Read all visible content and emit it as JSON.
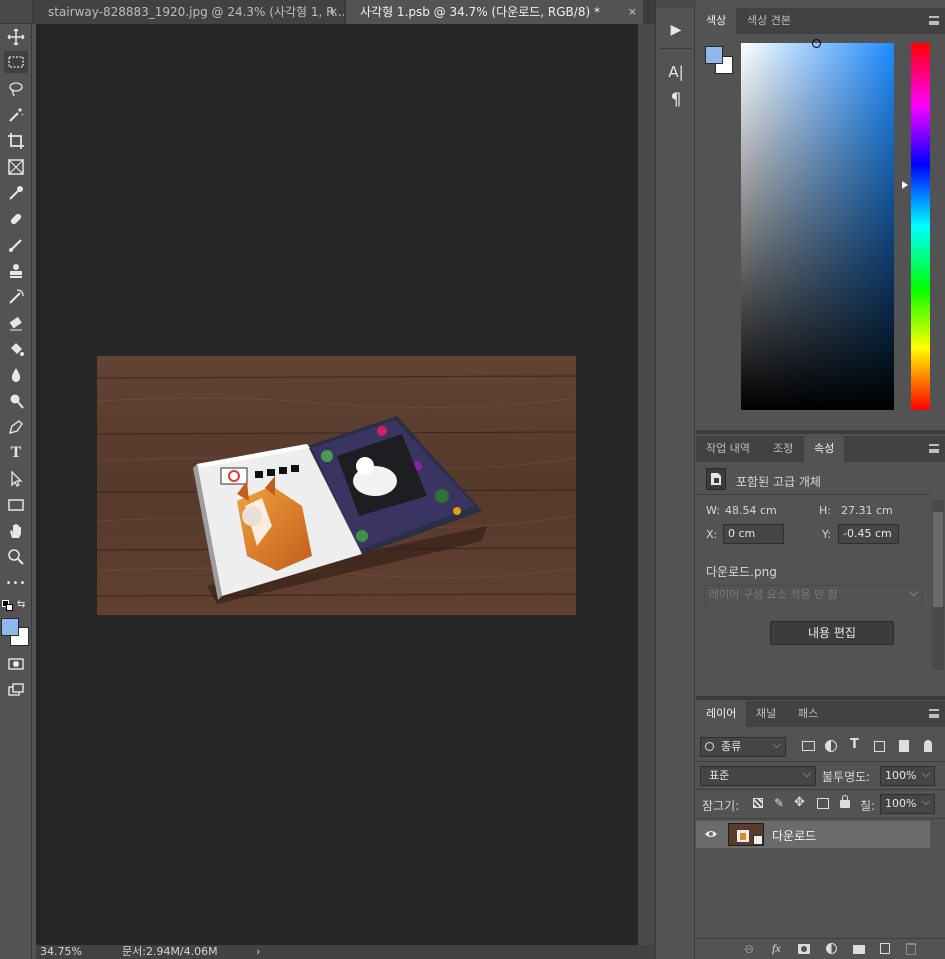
{
  "colors": {
    "foreground": "#8fb8ec",
    "background": "#ffffff",
    "canvas": "#262626",
    "panel": "#535353"
  },
  "tabs": [
    {
      "label": "stairway-828883_1920.jpg @ 24.3% (사각형 1, R...",
      "close": "×"
    },
    {
      "label": "사각형 1.psb @ 34.7% (다운로드, RGB/8) *",
      "close": "×"
    }
  ],
  "toolbar": {
    "icons": [
      "move-icon",
      "marquee-icon",
      "lasso-icon",
      "magic-wand-icon",
      "crop-icon",
      "frame-icon",
      "eyedropper-icon",
      "healing-brush-icon",
      "brush-icon",
      "clone-stamp-icon",
      "history-brush-icon",
      "eraser-icon",
      "paint-bucket-icon",
      "blur-icon",
      "dodge-icon",
      "pen-icon",
      "type-icon",
      "path-selection-icon",
      "rectangle-icon",
      "hand-icon",
      "zoom-icon",
      "more-tools-icon"
    ],
    "type_glyph": "T",
    "more_glyph": "•••"
  },
  "status": {
    "zoom": "34.75%",
    "doc": "문서:2.94M/4.06M",
    "arrow": "›"
  },
  "iconstrip": {
    "play": "▶",
    "char": "A|",
    "para": "¶"
  },
  "color_panel": {
    "tabs": [
      "색상",
      "색상 견본"
    ]
  },
  "properties_panel": {
    "tabs": [
      "작업 내역",
      "조정",
      "속성"
    ],
    "type_label": "포함된 고급 개체",
    "w_label": "W:",
    "w_value": "48.54 cm",
    "h_label": "H:",
    "h_value": "27.31 cm",
    "x_label": "X:",
    "x_value": "0 cm",
    "y_label": "Y:",
    "y_value": "-0.45 cm",
    "filename": "다운로드.png",
    "comp_dropdown": "레이어 구성 요소 적용 안 함",
    "edit_button": "내용 편집"
  },
  "layers_panel": {
    "tabs": [
      "레이어",
      "채널",
      "패스"
    ],
    "filter_kind": "종류",
    "blend_mode": "표준",
    "opacity_label": "불투명도:",
    "opacity_value": "100%",
    "lock_label": "잠그기:",
    "fill_label": "칠:",
    "fill_value": "100%",
    "layers": [
      {
        "name": "다운로드",
        "visible": true
      }
    ],
    "fx_glyph": "fx"
  }
}
